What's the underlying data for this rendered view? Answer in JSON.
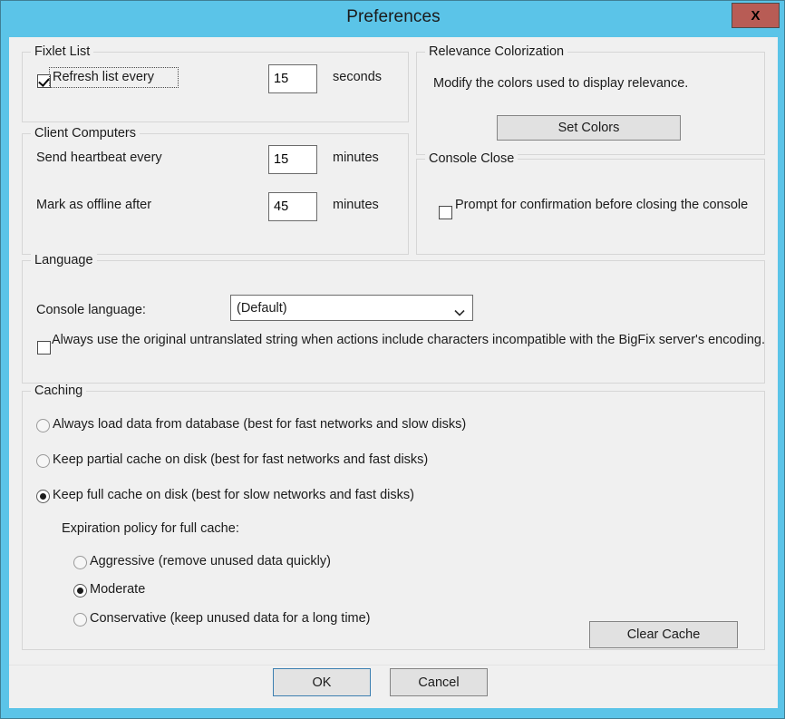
{
  "window": {
    "title": "Preferences",
    "close_label": "X",
    "titlebar_color": "#5bc4e8",
    "close_button_color": "#b85c55",
    "client_background": "#f0f0f0"
  },
  "fixlet_list": {
    "legend": "Fixlet List",
    "refresh_label": "Refresh list every",
    "refresh_checked": true,
    "refresh_value": "15",
    "refresh_unit": "seconds"
  },
  "client_computers": {
    "legend": "Client Computers",
    "heartbeat_label": "Send heartbeat every",
    "heartbeat_value": "15",
    "heartbeat_unit": "minutes",
    "offline_label": "Mark as offline after",
    "offline_value": "45",
    "offline_unit": "minutes"
  },
  "relevance_colorization": {
    "legend": "Relevance Colorization",
    "description": "Modify the colors used to display relevance.",
    "set_colors_label": "Set Colors"
  },
  "console_close": {
    "legend": "Console Close",
    "prompt_label": "Prompt for confirmation before closing the console",
    "prompt_checked": false
  },
  "language": {
    "legend": "Language",
    "console_language_label": "Console language:",
    "console_language_value": "(Default)",
    "untranslated_label": "Always use the original untranslated string when actions include characters incompatible with the BigFix server's encoding.",
    "untranslated_checked": false
  },
  "caching": {
    "legend": "Caching",
    "options": [
      {
        "label": "Always load data from database (best for fast networks and slow disks)",
        "selected": false
      },
      {
        "label": "Keep partial cache on disk (best for fast networks and fast disks)",
        "selected": false
      },
      {
        "label": "Keep full cache on disk (best for slow networks and fast disks)",
        "selected": true
      }
    ],
    "expiration_label": "Expiration policy for full cache:",
    "expiration_options": [
      {
        "label": "Aggressive (remove unused data quickly)",
        "selected": false
      },
      {
        "label": "Moderate",
        "selected": true
      },
      {
        "label": "Conservative (keep unused data for a long time)",
        "selected": false
      }
    ],
    "clear_cache_label": "Clear Cache"
  },
  "footer": {
    "ok_label": "OK",
    "cancel_label": "Cancel"
  }
}
